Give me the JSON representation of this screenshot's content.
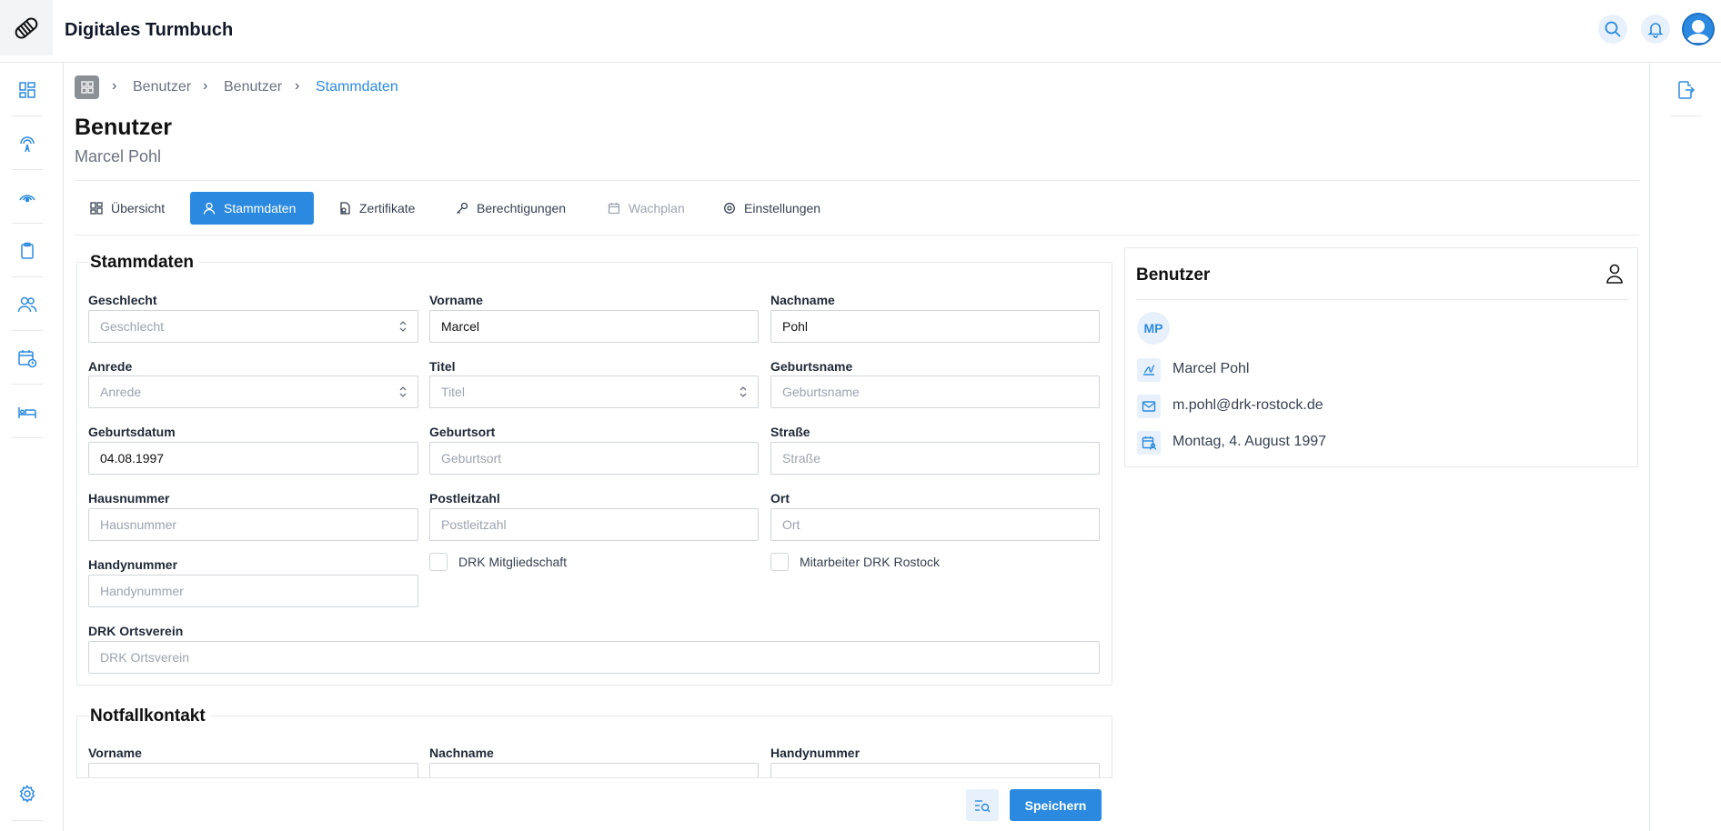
{
  "app": {
    "title": "Digitales Turmbuch"
  },
  "breadcrumb": [
    "Benutzer",
    "Benutzer",
    "Stammdaten"
  ],
  "page": {
    "title": "Benutzer",
    "subtitle": "Marcel Pohl"
  },
  "tabs": [
    {
      "label": "Übersicht",
      "icon": "grid-icon"
    },
    {
      "label": "Stammdaten",
      "icon": "user-icon"
    },
    {
      "label": "Zertifikate",
      "icon": "certificate-icon"
    },
    {
      "label": "Berechtigungen",
      "icon": "key-icon"
    },
    {
      "label": "Wachplan",
      "icon": "calendar-icon"
    },
    {
      "label": "Einstellungen",
      "icon": "gear-icon"
    }
  ],
  "stammdaten": {
    "title": "Stammdaten",
    "fields": {
      "geschlecht": {
        "label": "Geschlecht",
        "placeholder": "Geschlecht",
        "value": ""
      },
      "vorname": {
        "label": "Vorname",
        "placeholder": "",
        "value": "Marcel"
      },
      "nachname": {
        "label": "Nachname",
        "placeholder": "",
        "value": "Pohl"
      },
      "anrede": {
        "label": "Anrede",
        "placeholder": "Anrede",
        "value": ""
      },
      "titel": {
        "label": "Titel",
        "placeholder": "Titel",
        "value": ""
      },
      "geburtsname": {
        "label": "Geburtsname",
        "placeholder": "Geburtsname",
        "value": ""
      },
      "geburtsdatum": {
        "label": "Geburtsdatum",
        "placeholder": "",
        "value": "04.08.1997"
      },
      "geburtsort": {
        "label": "Geburtsort",
        "placeholder": "Geburtsort",
        "value": ""
      },
      "strasse": {
        "label": "Straße",
        "placeholder": "Straße",
        "value": ""
      },
      "hausnummer": {
        "label": "Hausnummer",
        "placeholder": "Hausnummer",
        "value": ""
      },
      "postleitzahl": {
        "label": "Postleitzahl",
        "placeholder": "Postleitzahl",
        "value": ""
      },
      "ort": {
        "label": "Ort",
        "placeholder": "Ort",
        "value": ""
      },
      "handynummer": {
        "label": "Handynummer",
        "placeholder": "Handynummer",
        "value": ""
      },
      "ortsverein": {
        "label": "DRK Ortsverein",
        "placeholder": "DRK Ortsverein",
        "value": ""
      }
    },
    "checkboxes": {
      "mitgliedschaft": {
        "label": "DRK Mitgliedschaft",
        "checked": false
      },
      "mitarbeiter": {
        "label": "Mitarbeiter DRK Rostock",
        "checked": false
      }
    }
  },
  "notfall": {
    "title": "Notfallkontakt",
    "labels": {
      "vorname": "Vorname",
      "nachname": "Nachname",
      "handynummer": "Handynummer"
    }
  },
  "card": {
    "title": "Benutzer",
    "initials": "MP",
    "name": "Marcel Pohl",
    "email": "m.pohl@drk-rostock.de",
    "birthday": "Montag, 4. August 1997"
  },
  "actions": {
    "save_label": "Speichern"
  },
  "colors": {
    "accent": "#2b8ae0",
    "accent_light": "#e8f1fb"
  }
}
